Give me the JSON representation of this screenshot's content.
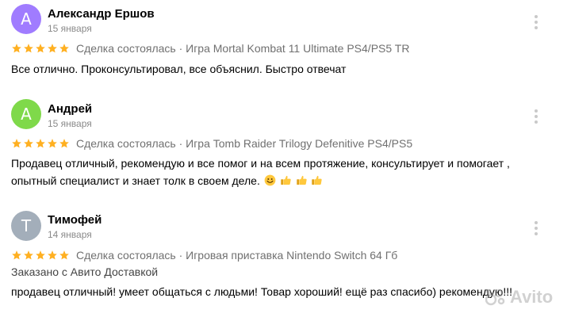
{
  "reviews": [
    {
      "avatar_letter": "А",
      "avatar_color": "#a07cff",
      "name": "Александр Ершов",
      "date": "15 января",
      "stars": 5,
      "deal": "Сделка состоялась · Игра Mortal Kombat 11 Ultimate PS4/PS5 TR",
      "text": "Все отлично. Проконсультировал, все объяснил. Быстро отвечат"
    },
    {
      "avatar_letter": "А",
      "avatar_color": "#7fd94a",
      "name": "Андрей",
      "date": "15 января",
      "stars": 5,
      "deal": "Сделка состоялась · Игра Tomb Raider Trilogy Defenitive PS4/PS5",
      "text_line1": "Продавец отличный, рекомендую и все помог и на всем протяжение, консультирует и помогает ,",
      "text_line2": "опытный специалист и знает толк в своем деле.",
      "emojis": [
        "smile-emoji",
        "thumbs-up-emoji",
        "thumbs-up-emoji",
        "thumbs-up-emoji"
      ]
    },
    {
      "avatar_letter": "Т",
      "avatar_color": "#a3aeba",
      "name": "Тимофей",
      "date": "14 января",
      "stars": 5,
      "deal": "Сделка состоялась · Игровая приставка Nintendo Switch 64 Гб",
      "delivery": "Заказано с Авито Доставкой",
      "text": "продавец отличный! умеет общаться с людьми! Товар хороший! ещё раз спасибо) рекомендую!!!"
    }
  ],
  "watermark": {
    "text": "Avito"
  },
  "colors": {
    "star": "#ffb021",
    "more_dots": "#c9c9c9"
  },
  "icons": {
    "more": "more-vertical-icon",
    "star": "star-icon"
  }
}
